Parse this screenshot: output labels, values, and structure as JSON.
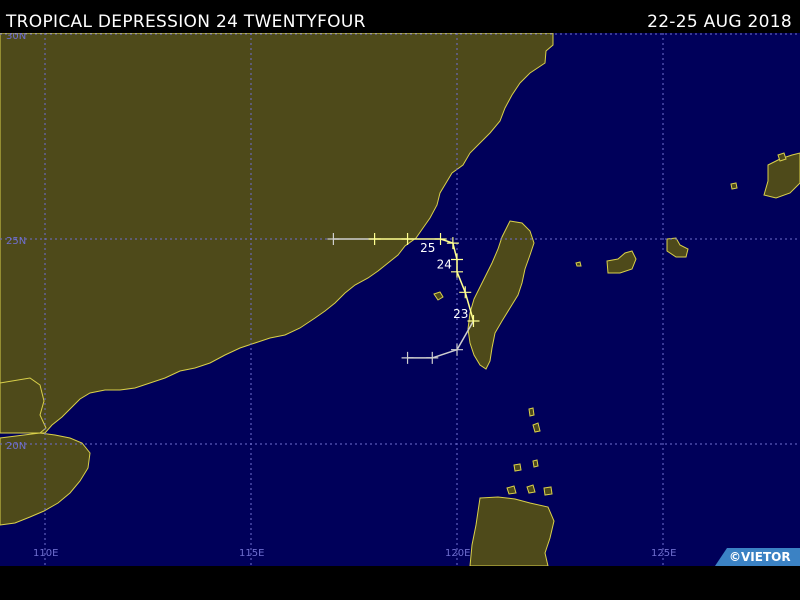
{
  "header": {
    "title": "TROPICAL DEPRESSION 24 TWENTYFOUR",
    "date_range": "22-25 AUG 2018"
  },
  "colors": {
    "ocean": "#00005a",
    "land": "#4e4a1a",
    "coast": "#d9d04a",
    "grid": "#6f6fd0",
    "grid_label": "#6f6fd0",
    "track": "#ffff90",
    "track_depression": "#cfcfcf"
  },
  "grid": {
    "lat_labels": [
      {
        "lat": 30,
        "text": "30N"
      },
      {
        "lat": 25,
        "text": "25N"
      },
      {
        "lat": 20,
        "text": "20N"
      }
    ],
    "lon_labels": [
      {
        "lon": 110,
        "text": "110E"
      },
      {
        "lon": 115,
        "text": "115E"
      },
      {
        "lon": 120,
        "text": "120E"
      },
      {
        "lon": 125,
        "text": "125E"
      }
    ]
  },
  "storm_track": {
    "points": [
      {
        "lon": 117.0,
        "lat": 25.0,
        "intensity": "remnant"
      },
      {
        "lon": 118.0,
        "lat": 25.0,
        "intensity": "depression"
      },
      {
        "lon": 118.8,
        "lat": 25.0,
        "intensity": "depression"
      },
      {
        "lon": 119.6,
        "lat": 25.0,
        "intensity": "depression"
      },
      {
        "lon": 119.9,
        "lat": 24.9,
        "intensity": "depression"
      },
      {
        "lon": 120.0,
        "lat": 24.5,
        "intensity": "depression"
      },
      {
        "lon": 120.0,
        "lat": 24.2,
        "intensity": "depression"
      },
      {
        "lon": 120.2,
        "lat": 23.7,
        "intensity": "depression"
      },
      {
        "lon": 120.4,
        "lat": 23.0,
        "intensity": "depression"
      },
      {
        "lon": 120.0,
        "lat": 22.3,
        "intensity": "remnant"
      },
      {
        "lon": 119.4,
        "lat": 22.1,
        "intensity": "remnant"
      },
      {
        "lon": 118.8,
        "lat": 22.1,
        "intensity": "remnant"
      }
    ],
    "day_labels": [
      {
        "text": "25",
        "lon": 119.3,
        "lat": 24.8
      },
      {
        "text": "24",
        "lon": 119.7,
        "lat": 24.4
      },
      {
        "text": "23",
        "lon": 120.1,
        "lat": 23.2
      }
    ]
  },
  "credit": "©VIETOR"
}
